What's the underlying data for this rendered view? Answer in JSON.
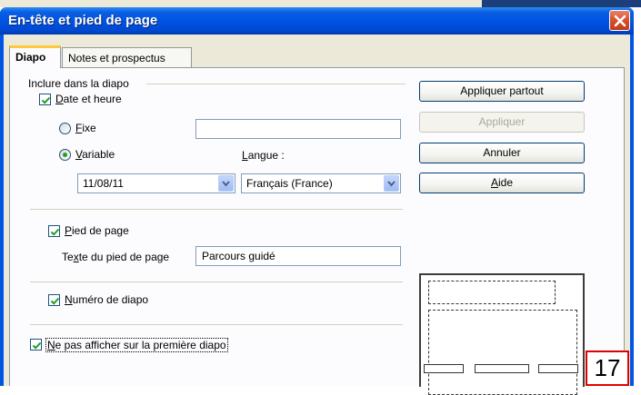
{
  "window": {
    "title": "En-tête et pied de page"
  },
  "tabs": [
    {
      "label": "Diapo",
      "active": true
    },
    {
      "label": "Notes et prospectus",
      "active": false
    }
  ],
  "include_group": {
    "label": "Inclure dans la diapo"
  },
  "date_time": {
    "checkbox_label_u": "D",
    "checkbox_label_rest": "ate et heure",
    "checked": true,
    "fixed": {
      "label_u": "F",
      "label_rest": "ixe",
      "selected": false,
      "value": ""
    },
    "variable": {
      "label_u": "V",
      "label_rest": "ariable",
      "selected": true
    },
    "date_format_value": "11/08/11",
    "language_label_u": "L",
    "language_label_rest": "angue :",
    "language_value": "Français (France)"
  },
  "footer": {
    "checkbox_label_u": "P",
    "checkbox_label_rest": "ied de page",
    "checked": true,
    "text_label_pre": "Te",
    "text_label_u": "x",
    "text_label_post": "te du pied de page",
    "text_value": "Parcours guidé"
  },
  "slide_number": {
    "checkbox_label_u": "N",
    "checkbox_label_rest": "uméro de diapo",
    "checked": true
  },
  "first_slide": {
    "checkbox_label_u": "N",
    "checkbox_label_pre": "",
    "checkbox_label_rest": "e pas afficher sur la première diapo",
    "checked": true
  },
  "buttons": {
    "apply_all": "Appliquer partout",
    "apply": "Appliquer",
    "cancel": "Annuler",
    "help_u": "A",
    "help_rest": "ide"
  },
  "page_badge": "17",
  "colors": {
    "titlebar": "#0054e3",
    "check_mark": "#21a121",
    "dialog_bg": "#ece9d8",
    "badge_border": "#e00000"
  }
}
